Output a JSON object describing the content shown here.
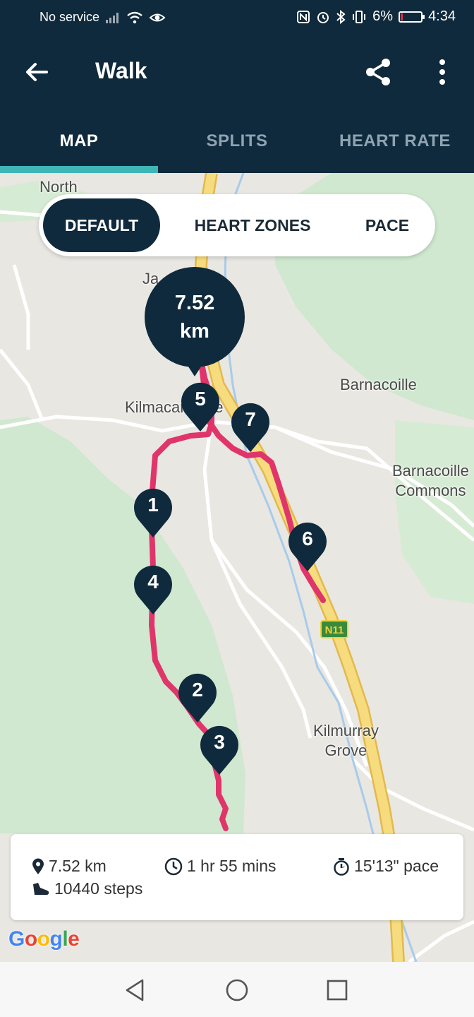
{
  "status_bar": {
    "carrier": "No service",
    "battery_percent": "6%",
    "battery_level": 0.06,
    "time": "4:34"
  },
  "app_bar": {
    "title": "Walk",
    "back_icon": "arrow-left-icon",
    "share_icon": "share-icon",
    "more_icon": "more-vertical-icon"
  },
  "tabs": [
    {
      "label": "MAP",
      "active": true
    },
    {
      "label": "SPLITS",
      "active": false
    },
    {
      "label": "HEART RATE",
      "active": false
    }
  ],
  "map_modes": [
    {
      "label": "DEFAULT",
      "active": true
    },
    {
      "label": "HEART ZONES",
      "active": false
    },
    {
      "label": "PACE",
      "active": false
    }
  ],
  "map": {
    "place_labels": {
      "north": "North",
      "jan": "Ja",
      "kilmacanogue": "Kilmacanogue",
      "barnacoille": "Barnacoille",
      "barnacoille_commons_1": "Barnacoille",
      "barnacoille_commons_2": "Commons",
      "kilmurray_1": "Kilmurray",
      "kilmurray_2": "Grove"
    },
    "road_label": "N11",
    "route_color": "#e0356a",
    "distance_bubble": {
      "value": "7.52",
      "unit": "km"
    },
    "km_markers": [
      "1",
      "2",
      "3",
      "4",
      "5",
      "6",
      "7"
    ]
  },
  "stats": {
    "distance": "7.52 km",
    "duration": "1 hr 55 mins",
    "pace": "15'13\" pace",
    "steps": "10440 steps"
  },
  "google_logo": "Google",
  "nav_bar": {
    "back_icon": "triangle-back-icon",
    "home_icon": "circle-home-icon",
    "recents_icon": "square-recents-icon"
  },
  "colors": {
    "header": "#0f2a3c",
    "tab_indicator": "#3fb5b7",
    "route": "#e0356a",
    "park_green": "#cfe8cf",
    "motorway_yellow": "#f3d372"
  }
}
